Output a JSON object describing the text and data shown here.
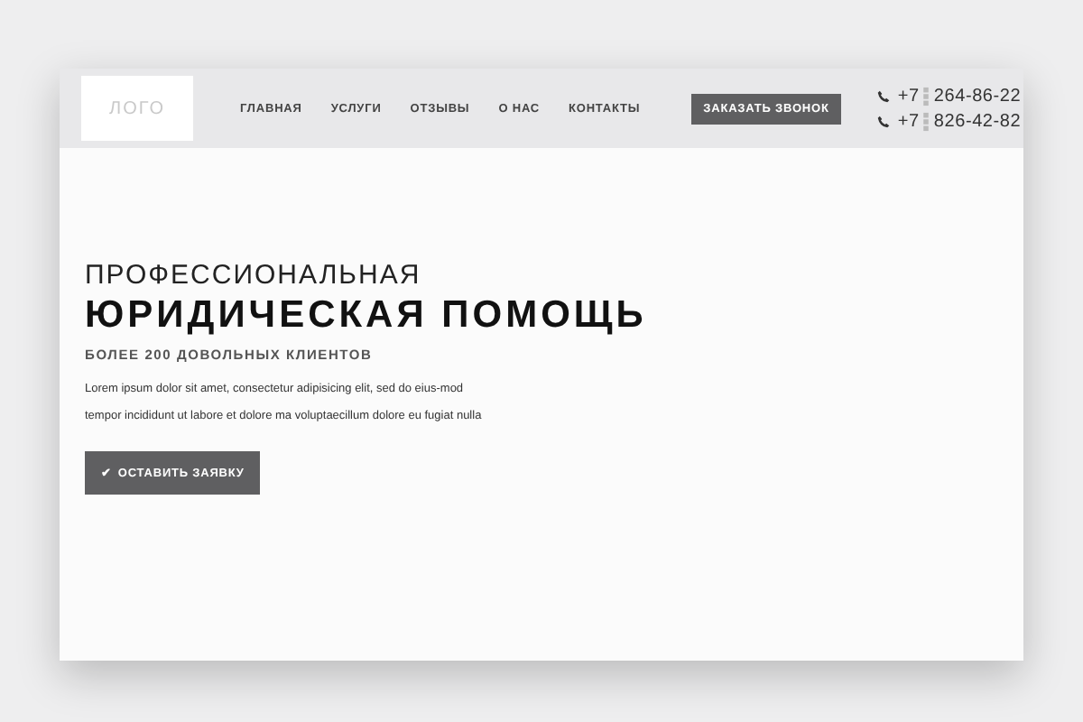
{
  "header": {
    "logo": "ЛОГО",
    "nav": [
      {
        "label": "ГЛАВНАЯ"
      },
      {
        "label": "УСЛУГИ"
      },
      {
        "label": "ОТЗЫВЫ"
      },
      {
        "label": "О НАС"
      },
      {
        "label": "КОНТАКТЫ"
      }
    ],
    "call_button": "ЗАКАЗАТЬ ЗВОНОК",
    "phones": [
      {
        "prefix": "+7",
        "number": "264-86-22"
      },
      {
        "prefix": "+7",
        "number": "826-42-82"
      }
    ]
  },
  "hero": {
    "subtitle": "ПРОФЕССИОНАЛЬНАЯ",
    "title": "ЮРИДИЧЕСКАЯ ПОМОЩЬ",
    "tagline": "БОЛЕЕ 200 ДОВОЛЬНЫХ КЛИЕНТОВ",
    "text": "Lorem ipsum dolor sit amet, consectetur adipisicing elit, sed do eius-mod tempor incididunt ut labore et dolore ma voluptaecillum dolore eu fugiat nulla",
    "button": {
      "icon": "✔",
      "label": "ОСТАВИТЬ ЗАЯВКУ"
    }
  }
}
